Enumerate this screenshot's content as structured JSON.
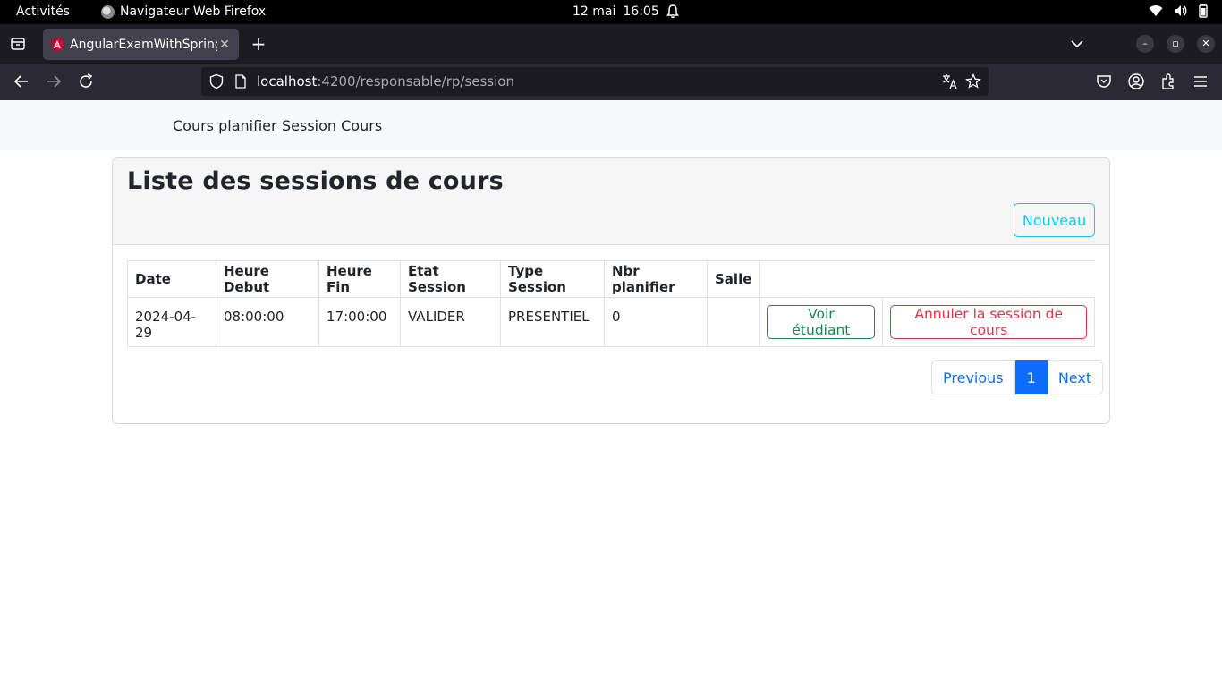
{
  "system_bar": {
    "activities": "Activités",
    "app_name": "Navigateur Web Firefox",
    "date": "12 mai",
    "time": "16:05"
  },
  "browser": {
    "tab_title": "AngularExamWithSpring",
    "url_host": "localhost",
    "url_path": ":4200/responsable/rp/session"
  },
  "app_nav": {
    "items": [
      "Cours planifier",
      "Session Cours"
    ]
  },
  "card": {
    "title": "Liste des sessions de cours",
    "new_button": "Nouveau"
  },
  "table": {
    "headers": [
      "Date",
      "Heure Debut",
      "Heure Fin",
      "Etat Session",
      "Type Session",
      "Nbr planifier",
      "Salle"
    ],
    "rows": [
      {
        "date": "2024-04-29",
        "heure_debut": "08:00:00",
        "heure_fin": "17:00:00",
        "etat": "VALIDER",
        "type": "PRESENTIEL",
        "nbr": "0",
        "salle": "",
        "voir_label": "Voir étudiant",
        "annuler_label": "Annuler la session de cours"
      }
    ]
  },
  "pagination": {
    "previous": "Previous",
    "current": "1",
    "next": "Next"
  },
  "colors": {
    "info": "#0dcaf0",
    "success": "#198754",
    "danger": "#dc3545",
    "primary": "#0d6efd"
  }
}
